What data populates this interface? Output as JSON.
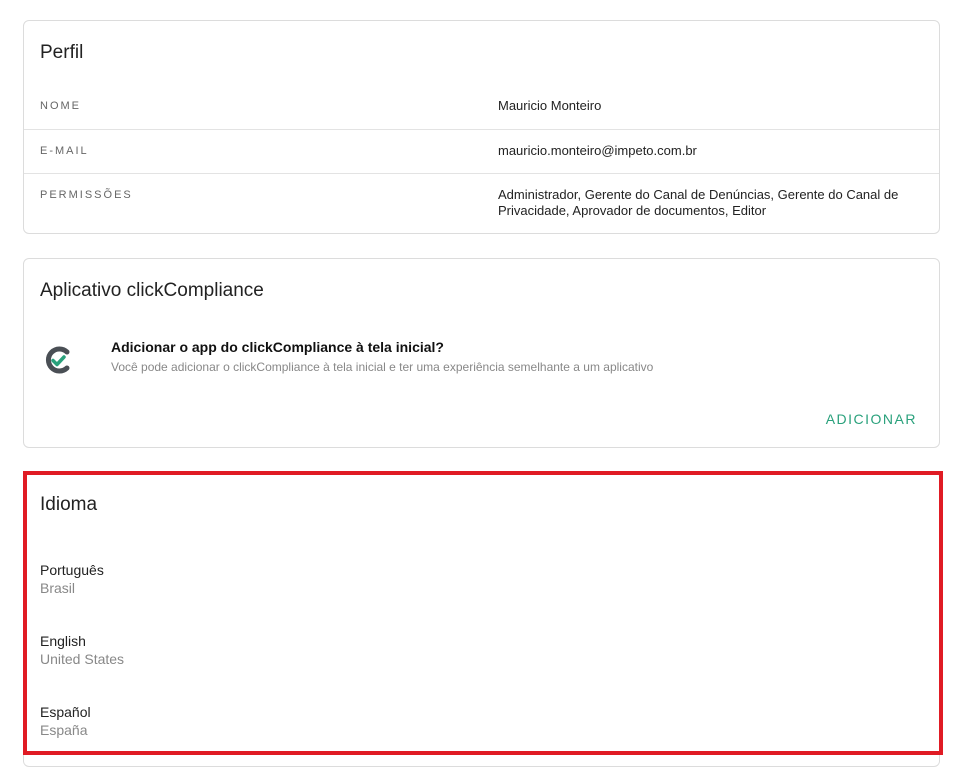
{
  "perfil": {
    "title": "Perfil",
    "rows": [
      {
        "label": "NOME",
        "value": "Mauricio Monteiro"
      },
      {
        "label": "E-MAIL",
        "value": "mauricio.monteiro@impeto.com.br"
      },
      {
        "label": "PERMISSÕES",
        "value": "Administrador, Gerente do Canal de Denúncias, Gerente do Canal de Privacidade, Aprovador de documentos, Editor"
      }
    ]
  },
  "app": {
    "title": "Aplicativo clickCompliance",
    "heading": "Adicionar o app do clickCompliance à tela inicial?",
    "description": "Você pode adicionar o clickCompliance à tela inicial e ter uma experiência semelhante a um aplicativo",
    "add_label": "ADICIONAR",
    "logo_icon": "clickcompliance-logo-icon",
    "accent_color": "#2aa17c"
  },
  "idioma": {
    "title": "Idioma",
    "languages": [
      {
        "name": "Português",
        "region": "Brasil"
      },
      {
        "name": "English",
        "region": "United States"
      },
      {
        "name": "Español",
        "region": "España"
      }
    ],
    "highlight_color": "#e01b24"
  }
}
